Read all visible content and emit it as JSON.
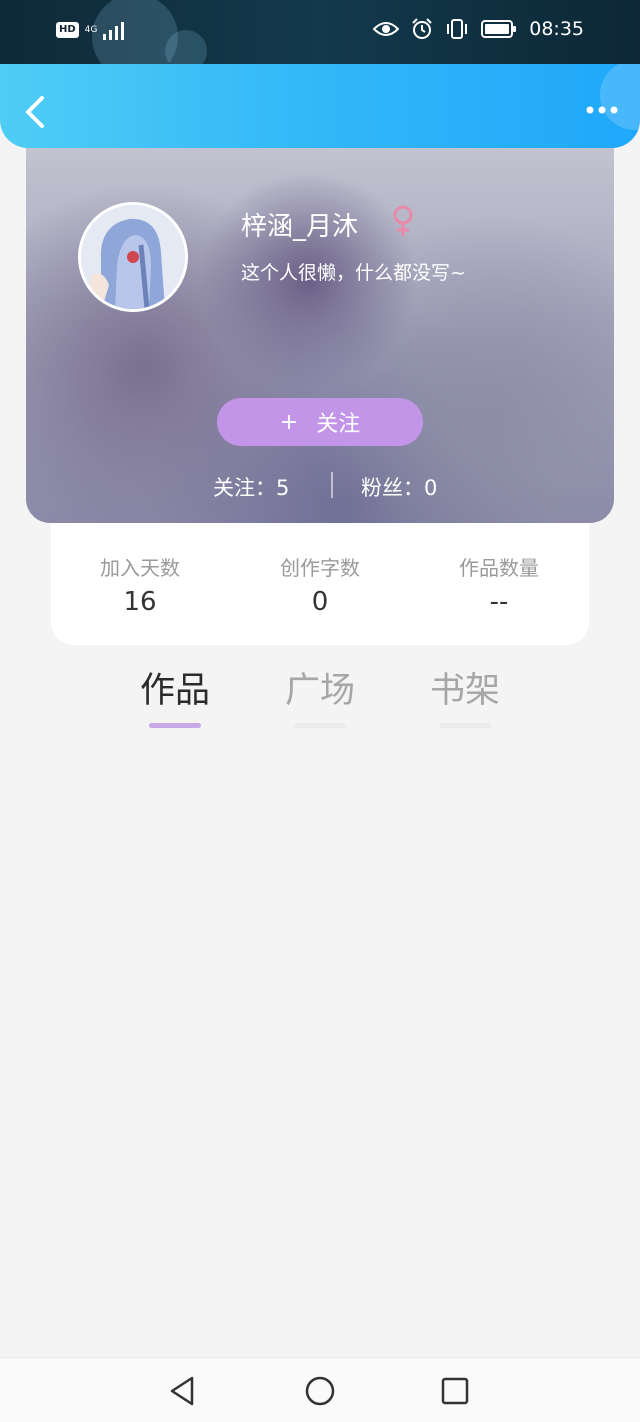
{
  "status_bar": {
    "hd_badge": "HD",
    "network": "4G",
    "time": "08:35",
    "icons": [
      "signal-icon",
      "eye-icon",
      "alarm-icon",
      "vibrate-icon",
      "battery-icon"
    ]
  },
  "header": {
    "back_icon": "chevron-left-icon",
    "more_icon": "more-dots-icon"
  },
  "profile": {
    "username": "梓涵_月沐",
    "gender_icon": "female-icon",
    "gender_color": "#e88aa8",
    "bio": "这个人很懒，什么都没写~",
    "follow_button": {
      "plus": "+",
      "label": "关注"
    },
    "following": "关注：5",
    "fans": "粉丝：0"
  },
  "info": {
    "days_label": "加入天数",
    "days_value": "16",
    "words_label": "创作字数",
    "words_value": "0",
    "works_label": "作品数量",
    "works_value": "--"
  },
  "tabs": [
    {
      "label": "作品",
      "active": true
    },
    {
      "label": "广场",
      "active": false
    },
    {
      "label": "书架",
      "active": false
    }
  ],
  "nav_bar": {
    "icons": [
      "back-triangle-icon",
      "home-circle-icon",
      "recents-square-icon"
    ]
  },
  "colors": {
    "header_start": "#4ecdf5",
    "header_end": "#1fa8fb",
    "follow_button": "#c295e8",
    "active_tab_indicator": "#c9a8e8"
  }
}
